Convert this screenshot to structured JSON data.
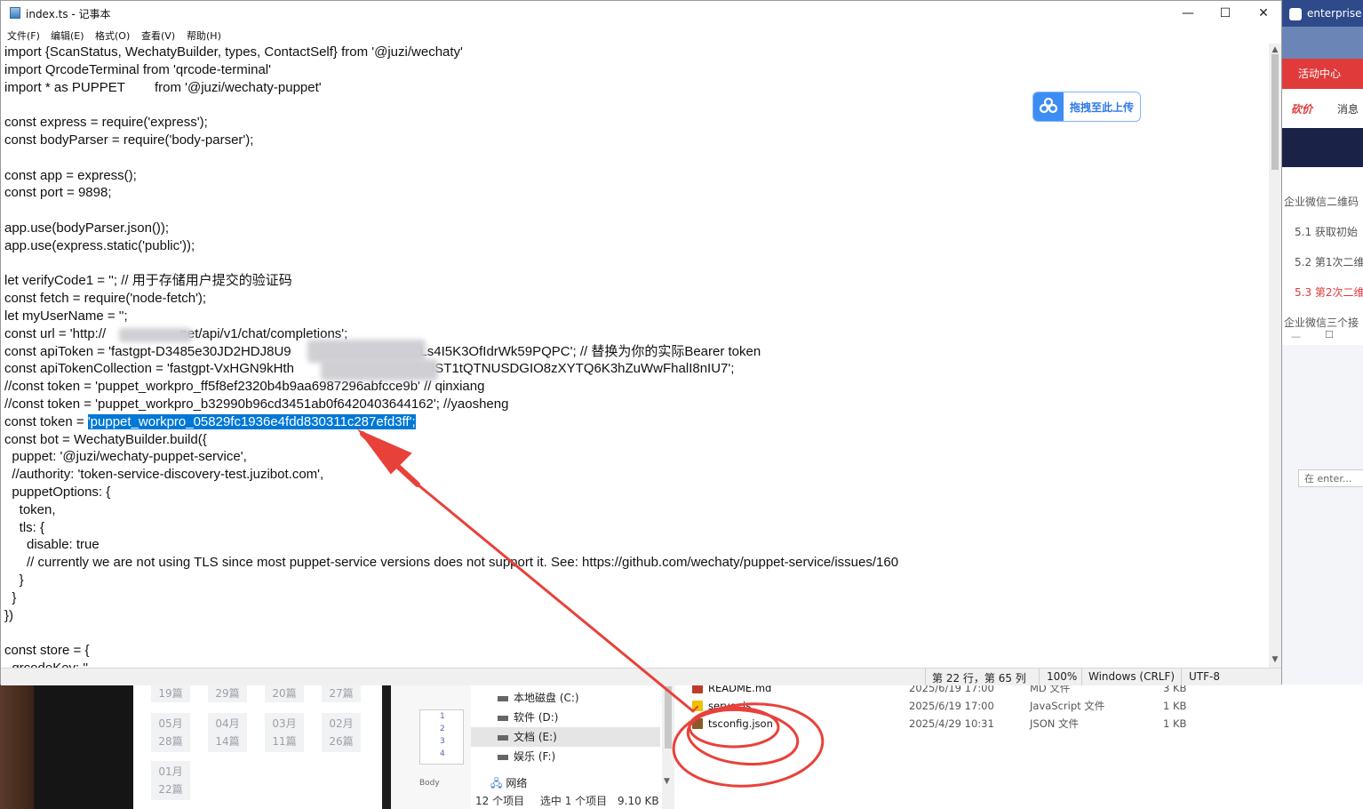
{
  "notepad": {
    "title": "index.ts - 记事本",
    "menu": [
      "文件(F)",
      "编辑(E)",
      "格式(O)",
      "查看(V)",
      "帮助(H)"
    ],
    "lines": [
      "import {ScanStatus, WechatyBuilder, types, ContactSelf} from '@juzi/wechaty'",
      "import QrcodeTerminal from 'qrcode-terminal'",
      "import * as PUPPET        from '@juzi/wechaty-puppet'",
      "",
      "const express = require('express');",
      "const bodyParser = require('body-parser');",
      "",
      "const app = express();",
      "const port = 9898;",
      "",
      "app.use(bodyParser.json());",
      "app.use(express.static('public'));",
      "",
      "let verifyCode1 = ''; // 用于存储用户提交的验证码",
      "const fetch = require('node-fetch');",
      "let myUserName = '';",
      "const url = 'http://                    net/api/v1/chat/completions';",
      "const apiToken = 'fastgpt-D3485e30JD2HDJ8U9                              YXLs4I5K3OfIdrWk59PQPC'; // 替换为你的实际Bearer token",
      "const apiTokenCollection = 'fastgpt-VxHGN9kHth                              yIDHST1tQTNUSDGIO8zXYTQ6K3hZuWwFhalI8nIU7';",
      "//const token = 'puppet_workpro_ff5f8ef2320b4b9aa6987296abfcce9b' // qinxiang",
      "//const token = 'puppet_workpro_b32990b96cd3451ab0f6420403644162'; //yaosheng",
      "__TOKEN__",
      "const bot = WechatyBuilder.build({",
      "  puppet: '@juzi/wechaty-puppet-service',",
      "  //authority: 'token-service-discovery-test.juzibot.com',",
      "  puppetOptions: {",
      "    token,",
      "    tls: {",
      "      disable: true",
      "      // currently we are not using TLS since most puppet-service versions does not support it. See: https://github.com/wechaty/puppet-service/issues/160",
      "    }",
      "  }",
      "})",
      "",
      "const store = {",
      "  qrcodeKey: ''"
    ],
    "token_line_prefix": "const token = ",
    "token_line_selected": "'puppet_workpro_05829fc1936e4fdd830311c287efd3ff';",
    "status": {
      "position": "第 22 行，第 65 列",
      "zoom": "100%",
      "line_ending": "Windows (CRLF)",
      "encoding": "UTF-8"
    }
  },
  "upload_button": {
    "label": "拖拽至此上传"
  },
  "browser": {
    "tab_title": "enterprise",
    "activity": "活动中心",
    "nav": [
      "砍价",
      "消息"
    ],
    "toc": [
      "企业微信二维码",
      "5.1 获取初始",
      "5.2 第1次二维",
      "5.3 第2次二维",
      "企业微信三个接"
    ],
    "search": "在 enter..."
  },
  "calendar": {
    "row1": [
      "19篇",
      "29篇",
      "20篇",
      "27篇"
    ],
    "row2_month": [
      "05月",
      "04月",
      "03月",
      "02月"
    ],
    "row2_count": [
      "28篇",
      "14篇",
      "11篇",
      "26篇"
    ],
    "row3_month": [
      "01月"
    ],
    "row3_count": [
      "22篇"
    ]
  },
  "explorer": {
    "drives": [
      "本地磁盘 (C:)",
      "软件 (D:)",
      "文档 (E:)",
      "娱乐 (F:)",
      "网络"
    ],
    "files": [
      {
        "name": "README.md",
        "date": "2025/6/19 17:00",
        "type": "MD 文件",
        "size": "3 KB"
      },
      {
        "name": "server.js",
        "date": "2025/6/19 17:00",
        "type": "JavaScript 文件",
        "size": "1 KB"
      },
      {
        "name": "tsconfig.json",
        "date": "2025/4/29 10:31",
        "type": "JSON 文件",
        "size": "1 KB"
      }
    ],
    "status_count": "12 个项目",
    "status_selected": "选中 1 个项目",
    "status_size": "9.10 KB",
    "side_body": "Body",
    "line_numbers": [
      "1",
      "2",
      "3",
      "4"
    ]
  },
  "colors": {
    "selection": "#0078d7",
    "annotation": "#e8413a"
  }
}
